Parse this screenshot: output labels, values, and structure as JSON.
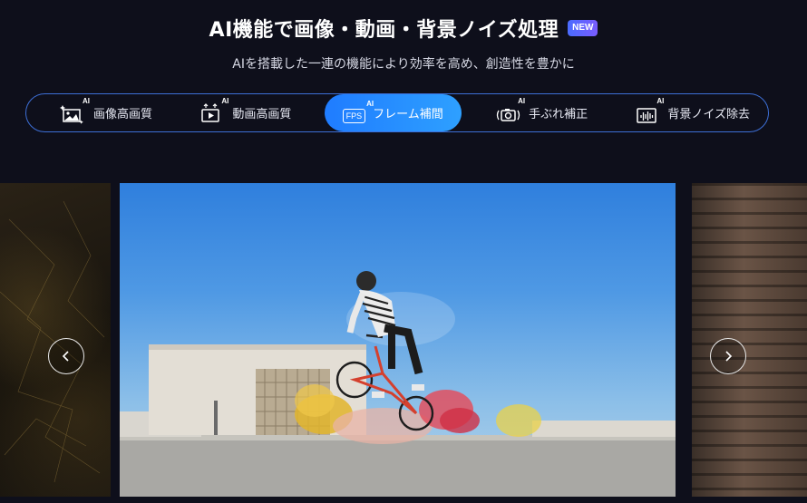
{
  "header": {
    "title": "AI機能で画像・動画・背景ノイズ処理",
    "badge": "NEW",
    "subtitle": "AIを搭載した一連の機能により効率を高め、創造性を豊かに"
  },
  "tabs": [
    {
      "label": "画像高画質",
      "icon": "image-enhance-icon",
      "ai": "AI",
      "active": false
    },
    {
      "label": "動画高画質",
      "icon": "video-enhance-icon",
      "ai": "AI",
      "active": false
    },
    {
      "label": "フレーム補間",
      "icon": "fps-icon",
      "icon_text": "FPS",
      "ai": "AI",
      "active": true
    },
    {
      "label": "手ぶれ補正",
      "icon": "stabilize-camera-icon",
      "ai": "AI",
      "active": false
    },
    {
      "label": "背景ノイズ除去",
      "icon": "noise-removal-icon",
      "ai": "AI",
      "active": false
    }
  ],
  "carousel": {
    "prev_icon": "chevron-left-icon",
    "next_icon": "chevron-right-icon",
    "main_image": "bmx-rider-colored-smoke-photo"
  },
  "colors": {
    "background": "#0e0f1b",
    "accent": "#1f7cff",
    "tab_border": "#3d6fd6"
  }
}
